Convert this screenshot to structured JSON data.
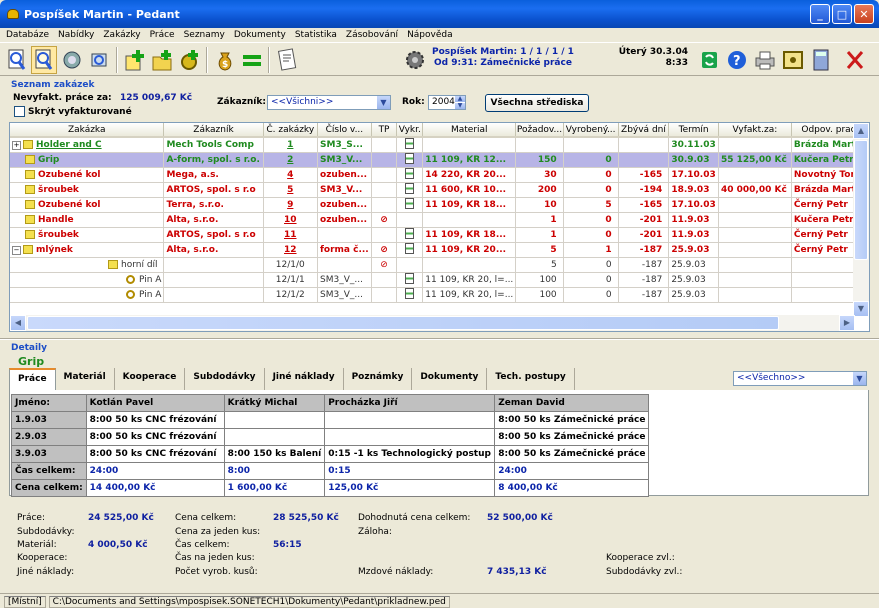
{
  "window": {
    "title": "Pospíšek Martin - Pedant"
  },
  "menu": [
    "Databáze",
    "Nabídky",
    "Zakázky",
    "Práce",
    "Seznamy",
    "Dokumenty",
    "Statistika",
    "Zásobování",
    "Nápověda"
  ],
  "toolbar": {
    "user_info": "Pospíšek Martin: 1 / 1 / 1 / 1",
    "work_info": "Od 9:31: Zámečnické práce",
    "date": "Úterý 30.3.04",
    "time": "8:33"
  },
  "orders": {
    "group_title": "Seznam zakázek",
    "unbilled_label": "Nevyfakt. práce za:",
    "unbilled_value": "125 009,67 Kč",
    "hide_label": "Skrýt vyfakturované",
    "customer_label": "Zákazník:",
    "customer_value": "<<Všichni>>",
    "year_label": "Rok:",
    "year_value": "2004",
    "all_centers_button": "Všechna střediska"
  },
  "grid": {
    "columns": [
      "Zakázka",
      "Zákazník",
      "Č. zakázky",
      "Číslo v...",
      "TP",
      "Vykr.",
      "Material",
      "Požadov...",
      "Vyrobený...",
      "Zbývá dní",
      "Termín",
      "Vyfakt.za:",
      "Odpov. prac."
    ],
    "rows": [
      {
        "expander": "+",
        "name": "Holder and C",
        "customer": "Mech Tools Comp",
        "num": "1",
        "ver": "SM3_S...",
        "tp": "",
        "vykr": true,
        "material": "",
        "req": "",
        "made": "",
        "days": "",
        "term": "30.11.03",
        "billed": "",
        "resp": "Brázda Martin",
        "color": "#1f8a1f",
        "underline": true
      },
      {
        "expander": "",
        "name": "Grip",
        "customer": "A-form, spol. s r.o.",
        "num": "2",
        "ver": "SM3_V...",
        "tp": "",
        "vykr": true,
        "material": "11 109, KR 12...",
        "req": "150",
        "made": "0",
        "days": "",
        "term": "30.9.03",
        "billed": "55 125,00 Kč",
        "resp": "Kučera Petr",
        "color": "#1f8a1f",
        "selected": true
      },
      {
        "expander": "",
        "name": "Ozubené kol",
        "customer": "Mega, a.s.",
        "num": "4",
        "ver": "ozuben...",
        "tp": "",
        "vykr": true,
        "material": "14 220, KR 20...",
        "req": "30",
        "made": "0",
        "days": "-165",
        "term": "17.10.03",
        "billed": "",
        "resp": "Novotný Tomá",
        "color": "#cc0000"
      },
      {
        "expander": "",
        "name": "šroubek",
        "customer": "ARTOS, spol. s r.o",
        "num": "5",
        "ver": "SM3_V...",
        "tp": "",
        "vykr": true,
        "material": "11 600, KR 10...",
        "req": "200",
        "made": "0",
        "days": "-194",
        "term": "18.9.03",
        "billed": "40 000,00 Kč",
        "resp": "Brázda Martin",
        "color": "#cc0000"
      },
      {
        "expander": "",
        "name": "Ozubené kol",
        "customer": "Terra, s.r.o.",
        "num": "9",
        "ver": "ozuben...",
        "tp": "",
        "vykr": true,
        "material": "11 109, KR 18...",
        "req": "10",
        "made": "5",
        "days": "-165",
        "term": "17.10.03",
        "billed": "",
        "resp": "Černý Petr",
        "color": "#cc0000"
      },
      {
        "expander": "",
        "name": "Handle",
        "customer": "Alta, s.r.o.",
        "num": "10",
        "ver": "ozuben...",
        "tp": "⊘",
        "vykr": false,
        "material": "",
        "req": "1",
        "made": "0",
        "days": "-201",
        "term": "11.9.03",
        "billed": "",
        "resp": "Kučera Petr",
        "color": "#cc0000"
      },
      {
        "expander": "",
        "name": "šroubek",
        "customer": "ARTOS, spol. s r.o",
        "num": "11",
        "ver": "",
        "tp": "",
        "vykr": true,
        "material": "11 109, KR 18...",
        "req": "1",
        "made": "0",
        "days": "-201",
        "term": "11.9.03",
        "billed": "",
        "resp": "Černý Petr",
        "color": "#cc0000"
      },
      {
        "expander": "−",
        "name": "mlýnek",
        "customer": "Alta, s.r.o.",
        "num": "12",
        "ver": "forma č...",
        "tp": "⊘",
        "vykr": true,
        "material": "11 109, KR 20...",
        "req": "5",
        "made": "1",
        "days": "-187",
        "term": "25.9.03",
        "billed": "",
        "resp": "Černý Petr",
        "color": "#cc0000"
      },
      {
        "expander": "",
        "name": "horní díl",
        "customer": "",
        "num": "12/1/0",
        "ver": "",
        "tp": "⊘",
        "vykr": false,
        "material": "",
        "req": "5",
        "made": "0",
        "days": "-187",
        "term": "25.9.03",
        "billed": "",
        "resp": "",
        "color": "#cc0000",
        "sub": 1
      },
      {
        "expander": "",
        "name": "Pin A",
        "customer": "",
        "num": "12/1/1",
        "ver": "SM3_V_...",
        "tp": "",
        "vykr": true,
        "material": "11 109, KR 20, l=...",
        "req": "100",
        "made": "0",
        "days": "-187",
        "term": "25.9.03",
        "billed": "",
        "resp": "",
        "color": "#cc0000",
        "sub": 2
      },
      {
        "expander": "",
        "name": "Pin A",
        "customer": "",
        "num": "12/1/2",
        "ver": "SM3_V_...",
        "tp": "",
        "vykr": true,
        "material": "11 109, KR 20, l=...",
        "req": "100",
        "made": "0",
        "days": "-187",
        "term": "25.9.03",
        "billed": "",
        "resp": "",
        "color": "#cc0000",
        "sub": 2
      }
    ]
  },
  "details": {
    "group_title": "Detaily",
    "item_name": "Grip",
    "tabs": [
      "Práce",
      "Materiál",
      "Kooperace",
      "Subdodávky",
      "Jiné náklady",
      "Poznámky",
      "Dokumenty",
      "Tech. postupy"
    ],
    "filter": "<<Všechno>>",
    "work_header": [
      "Jméno:",
      "Kotlán Pavel",
      "Krátký Michal",
      "Procházka Jiří",
      "Zeman David"
    ],
    "work_rows": [
      [
        "1.9.03",
        "8:00   50 ks CNC frézování",
        "",
        "",
        "8:00   50 ks Zámečnické práce"
      ],
      [
        "2.9.03",
        "8:00   50 ks CNC frézování",
        "",
        "",
        "8:00   50 ks Zámečnické práce"
      ],
      [
        "3.9.03",
        "8:00   50 ks CNC frézování",
        "8:00   150 ks Balení",
        "0:15   -1 ks Technologický postup",
        "8:00   50 ks Zámečnické práce"
      ]
    ],
    "time_total": [
      "Čas celkem:",
      "24:00",
      "8:00",
      "0:15",
      "24:00"
    ],
    "price_total": [
      "Cena celkem:",
      "14 400,00 Kč",
      "1 600,00 Kč",
      "125,00 Kč",
      "8 400,00 Kč"
    ]
  },
  "summary": {
    "work_label": "Práce:",
    "work_value": "24 525,00 Kč",
    "subdel_label": "Subdodávky:",
    "material_label": "Materiál:",
    "material_value": "4 000,50 Kč",
    "coop_label": "Kooperace:",
    "other_label": "Jiné náklady:",
    "price_total_label": "Cena celkem:",
    "price_total_value": "28 525,50 Kč",
    "price_per_label": "Cena za jeden kus:",
    "time_total_label": "Čas celkem:",
    "time_total_value": "56:15",
    "time_per_label": "Čas na jeden kus:",
    "pieces_label": "Počet vyrob. kusů:",
    "agreed_label": "Dohodnutá cena celkem:",
    "agreed_value": "52 500,00 Kč",
    "deposit_label": "Záloha:",
    "wage_label": "Mzdové náklady:",
    "wage_value": "7 435,13 Kč",
    "coop_rem_label": "Kooperace zvl.:",
    "subdel_rem_label": "Subdodávky zvl.:"
  },
  "status": {
    "mode": "[Místní]",
    "path": "C:\\Documents and Settings\\mpospisek.SONETECH1\\Dokumenty\\Pedant\\prikladnew.ped"
  }
}
